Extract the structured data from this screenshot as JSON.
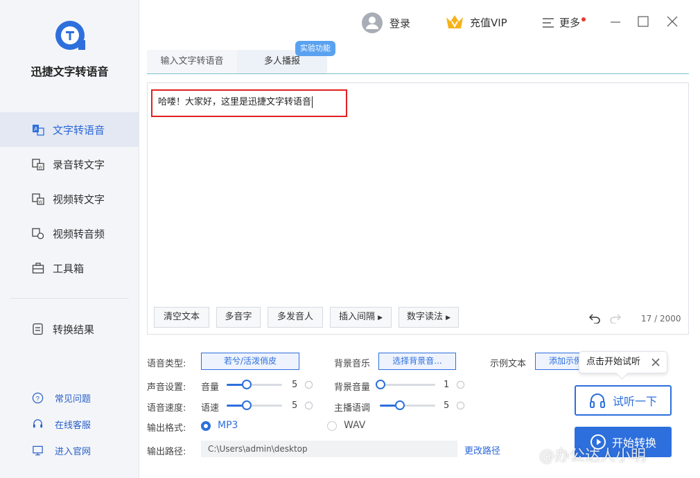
{
  "app": {
    "name": "迅捷文字转语音"
  },
  "colors": {
    "primary": "#2d6fdc",
    "highlight_border": "#e02020",
    "badge": "#5aa2f0"
  },
  "sidebar": {
    "items": [
      {
        "label": "文字转语音",
        "icon": "text-to-speech-icon",
        "active": true
      },
      {
        "label": "录音转文字",
        "icon": "audio-to-text-icon"
      },
      {
        "label": "视频转文字",
        "icon": "video-to-text-icon"
      },
      {
        "label": "视频转音频",
        "icon": "video-to-audio-icon"
      },
      {
        "label": "工具箱",
        "icon": "toolbox-icon"
      }
    ],
    "result": {
      "label": "转换结果",
      "icon": "result-icon"
    },
    "footer": [
      {
        "label": "常见问题",
        "icon": "question-icon"
      },
      {
        "label": "在线客服",
        "icon": "headset-icon"
      },
      {
        "label": "进入官网",
        "icon": "monitor-icon"
      }
    ]
  },
  "topbar": {
    "login": "登录",
    "vip": "充值VIP",
    "more": "更多"
  },
  "tabs": [
    {
      "label": "输入文字转语音"
    },
    {
      "label": "多人播报"
    }
  ],
  "badge": "实验功能",
  "editor": {
    "text": "哈喽！大家好，这里是迅捷文字转语音",
    "buttons": {
      "clear": "清空文本",
      "polyphone": "多音字",
      "multi_speaker": "多发音人",
      "insert_pause": "插入间隔",
      "number_read": "数字读法"
    },
    "count": "17 / 2000"
  },
  "settings": {
    "voice_type": {
      "label": "语音类型:",
      "value": "若兮/活泼俏皮"
    },
    "bg_music": {
      "label": "背景音乐",
      "button": "选择背景音..."
    },
    "sample_text": {
      "label": "示例文本",
      "button": "添加示例"
    },
    "sound": {
      "label": "声音设置:",
      "volume_label": "音量",
      "volume": 5
    },
    "bg_volume": {
      "label": "背景音量",
      "value": 1
    },
    "speed": {
      "label": "语音速度:",
      "sub_label": "语速",
      "value": 5
    },
    "pitch": {
      "label": "主播语调",
      "value": 5
    },
    "format": {
      "label": "输出格式:",
      "options": [
        "MP3",
        "WAV"
      ],
      "selected": "MP3"
    },
    "path": {
      "label": "输出路径:",
      "value": "C:\\Users\\admin\\desktop",
      "change": "更改路径"
    }
  },
  "actions": {
    "tooltip": "点击开始试听",
    "listen": "试听一下",
    "start": "开始转换"
  },
  "watermark": "@办公达人小明"
}
